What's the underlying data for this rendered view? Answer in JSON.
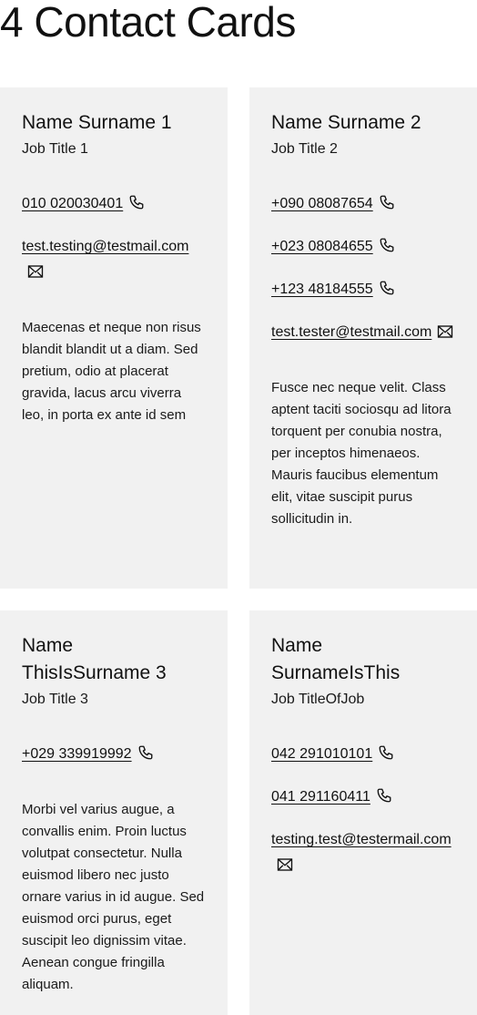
{
  "page": {
    "title": "4 Contact Cards"
  },
  "cards": [
    {
      "name": "Name Surname 1",
      "job_title": "Job Title 1",
      "phones": [
        "010 020030401"
      ],
      "email": "test.testing@testmail.com",
      "bio": "Maecenas et neque non risus blandit blandit ut a diam. Sed pretium, odio at placerat gravida, lacus arcu viverra leo, in porta ex ante id sem"
    },
    {
      "name": "Name Surname 2",
      "job_title": "Job Title 2",
      "phones": [
        "+090 08087654",
        "+023 08084655",
        "+123 48184555"
      ],
      "email": "test.tester@testmail.com",
      "bio": "Fusce nec neque velit. Class aptent taciti sociosqu ad litora torquent per conubia nostra, per inceptos himenaeos. Mauris faucibus elementum elit, vitae suscipit purus sollicitudin in."
    },
    {
      "name": "Name ThisIsSurname 3",
      "job_title": "Job Title 3",
      "phones": [
        "+029 339919992"
      ],
      "email": "",
      "bio": "Morbi vel varius augue, a convallis enim. Proin luctus volutpat consectetur. Nulla euismod libero nec justo ornare varius in id augue. Sed euismod orci purus, eget suscipit leo dignissim vitae. Aenean congue fringilla aliquam."
    },
    {
      "name": "Name SurnameIsThis",
      "job_title": "Job TitleOfJob",
      "phones": [
        "042 291010101",
        "041 291160411"
      ],
      "email": "testing.test@testermail.com",
      "bio": ""
    }
  ],
  "icons": {
    "phone": "phone-icon",
    "email": "envelope-icon"
  }
}
